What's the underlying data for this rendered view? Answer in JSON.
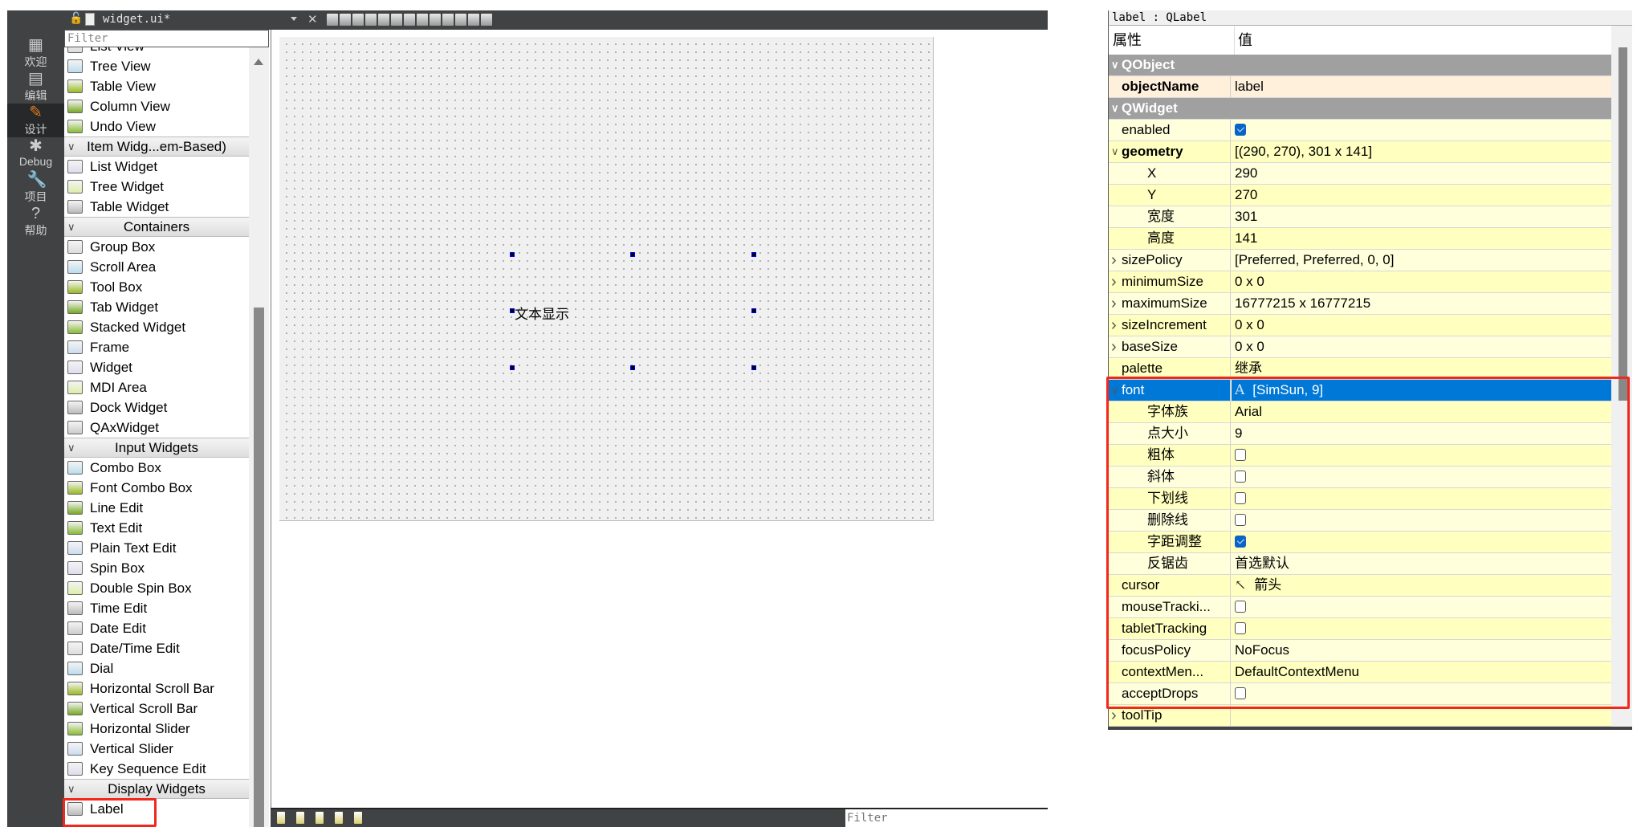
{
  "mode_bar": [
    {
      "label": "欢迎",
      "icon": "grid-icon"
    },
    {
      "label": "编辑",
      "icon": "document-icon"
    },
    {
      "label": "设计",
      "icon": "pencil-icon",
      "active": true
    },
    {
      "label": "Debug",
      "icon": "bug-icon"
    },
    {
      "label": "项目",
      "icon": "wrench-icon"
    },
    {
      "label": "帮助",
      "icon": "help-icon"
    }
  ],
  "widget_box": {
    "file_tab": "widget.ui*",
    "filter_placeholder": "Filter",
    "entries": [
      {
        "label": "List View"
      },
      {
        "label": "Tree View"
      },
      {
        "label": "Table View"
      },
      {
        "label": "Column View"
      },
      {
        "label": "Undo View"
      },
      {
        "label": "Item Widg...em-Based)",
        "header": true
      },
      {
        "label": "List Widget"
      },
      {
        "label": "Tree Widget"
      },
      {
        "label": "Table Widget"
      },
      {
        "label": "Containers",
        "header": true
      },
      {
        "label": "Group Box"
      },
      {
        "label": "Scroll Area"
      },
      {
        "label": "Tool Box"
      },
      {
        "label": "Tab Widget"
      },
      {
        "label": "Stacked Widget"
      },
      {
        "label": "Frame"
      },
      {
        "label": "Widget"
      },
      {
        "label": "MDI Area"
      },
      {
        "label": "Dock Widget"
      },
      {
        "label": "QAxWidget"
      },
      {
        "label": "Input Widgets",
        "header": true
      },
      {
        "label": "Combo Box"
      },
      {
        "label": "Font Combo Box"
      },
      {
        "label": "Line Edit"
      },
      {
        "label": "Text Edit"
      },
      {
        "label": "Plain Text Edit"
      },
      {
        "label": "Spin Box"
      },
      {
        "label": "Double Spin Box"
      },
      {
        "label": "Time Edit"
      },
      {
        "label": "Date Edit"
      },
      {
        "label": "Date/Time Edit"
      },
      {
        "label": "Dial"
      },
      {
        "label": "Horizontal Scroll Bar"
      },
      {
        "label": "Vertical Scroll Bar"
      },
      {
        "label": "Horizontal Slider"
      },
      {
        "label": "Vertical Slider"
      },
      {
        "label": "Key Sequence Edit"
      },
      {
        "label": "Display Widgets",
        "header": true
      },
      {
        "label": "Label",
        "highlighted": true
      }
    ]
  },
  "editor": {
    "label_text": "文本显示",
    "bottom_filter_placeholder": "Filter"
  },
  "property_editor": {
    "object_title": "label : QLabel",
    "col_property": "属性",
    "col_value": "值",
    "rows": [
      {
        "name": "QObject",
        "group": true
      },
      {
        "name": "objectName",
        "value": "label",
        "bold": true,
        "kind": "name"
      },
      {
        "name": "QWidget",
        "group": true
      },
      {
        "name": "enabled",
        "checkbox": true
      },
      {
        "name": "geometry",
        "value": "[(290, 270), 301 x 141]",
        "bold": true,
        "expanded": true
      },
      {
        "name": "X",
        "value": "290",
        "sub": true
      },
      {
        "name": "Y",
        "value": "270",
        "sub": true
      },
      {
        "name": "宽度",
        "value": "301",
        "sub": true
      },
      {
        "name": "高度",
        "value": "141",
        "sub": true
      },
      {
        "name": "sizePolicy",
        "value": "[Preferred, Preferred, 0, 0]",
        "collapsed": true
      },
      {
        "name": "minimumSize",
        "value": "0 x 0",
        "collapsed": true
      },
      {
        "name": "maximumSize",
        "value": "16777215 x 16777215",
        "collapsed": true
      },
      {
        "name": "sizeIncrement",
        "value": "0 x 0",
        "collapsed": true
      },
      {
        "name": "baseSize",
        "value": "0 x 0",
        "collapsed": true
      },
      {
        "name": "palette",
        "value": "继承"
      },
      {
        "name": "font",
        "value": "[SimSun, 9]",
        "expanded": true,
        "selected": true,
        "icon": "font-icon",
        "icon_glyph": "A"
      },
      {
        "name": "字体族",
        "value": "Arial",
        "sub": true
      },
      {
        "name": "点大小",
        "value": "9",
        "sub": true
      },
      {
        "name": "粗体",
        "checkbox": false,
        "sub": true
      },
      {
        "name": "斜体",
        "checkbox": false,
        "sub": true
      },
      {
        "name": "下划线",
        "checkbox": false,
        "sub": true
      },
      {
        "name": "删除线",
        "checkbox": false,
        "sub": true
      },
      {
        "name": "字距调整",
        "checkbox": true,
        "sub": true
      },
      {
        "name": "反锯齿",
        "value": "首选默认",
        "sub": true
      },
      {
        "name": "cursor",
        "value": "箭头",
        "icon": "arrow-cursor-icon",
        "icon_glyph": "↖"
      },
      {
        "name": "mouseTracki...",
        "checkbox": false
      },
      {
        "name": "tabletTracking",
        "checkbox": false
      },
      {
        "name": "focusPolicy",
        "value": "NoFocus"
      },
      {
        "name": "contextMen...",
        "value": "DefaultContextMenu"
      },
      {
        "name": "acceptDrops",
        "checkbox": false
      },
      {
        "name": "toolTip",
        "value": "",
        "collapsed": true
      }
    ]
  },
  "colors": {
    "accent": "#0078d7",
    "highlight_box": "#f0281e",
    "group_row": "#a0a0a0",
    "object_row": "#fff0dc",
    "row_light": "#ffffdc",
    "row_dark": "#ffffbf",
    "dark_chrome": "#404244"
  }
}
